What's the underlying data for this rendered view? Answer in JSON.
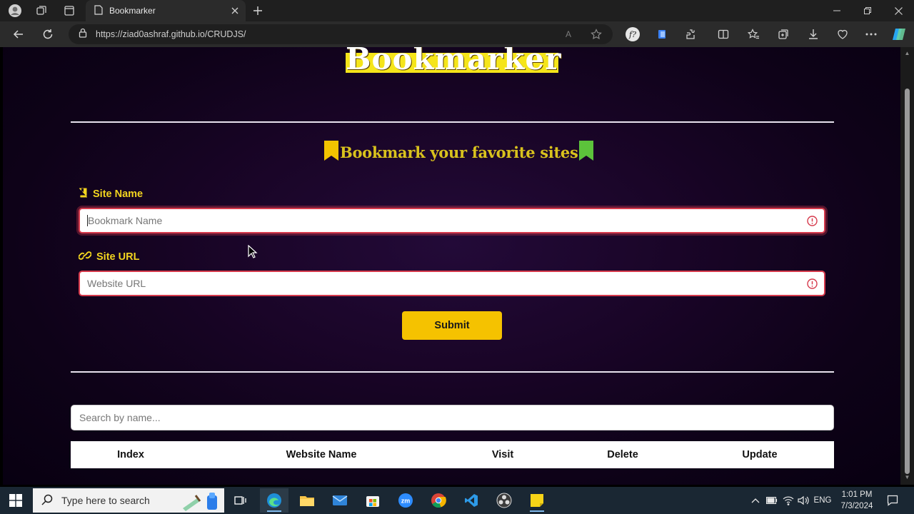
{
  "browser": {
    "tab_title": "Bookmarker",
    "url": "https://ziad0ashraf.github.io/CRUDJS/",
    "read_aloud_label": "A"
  },
  "page": {
    "logo": "Bookmarker",
    "subheading": "Bookmark your favorite sites",
    "site_name_label": "Site Name",
    "site_name_placeholder": "Bookmark Name",
    "site_url_label": "Site URL",
    "site_url_placeholder": "Website URL",
    "submit_label": "Submit",
    "search_placeholder": "Search by name...",
    "table_headers": [
      "Index",
      "Website Name",
      "Visit",
      "Delete",
      "Update"
    ]
  },
  "taskbar": {
    "search_placeholder": "Type here to search",
    "language": "ENG",
    "time": "1:01 PM",
    "date": "7/3/2024",
    "zoom_label": "zm"
  },
  "colors": {
    "accent_yellow": "#f5c200",
    "label_yellow": "#f2d41f",
    "invalid_red": "#d63a4c",
    "page_bg": "#1a0528"
  }
}
